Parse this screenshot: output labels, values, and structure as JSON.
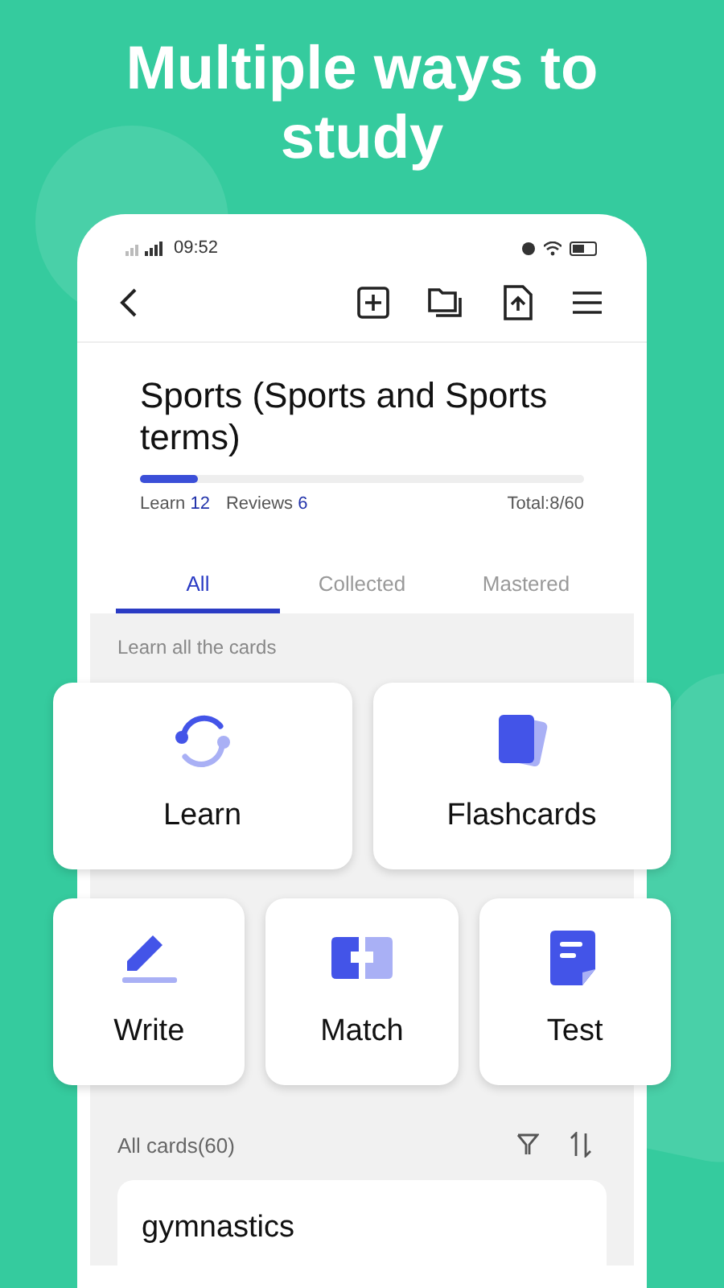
{
  "headline": "Multiple ways to study",
  "status_bar": {
    "time": "09:52"
  },
  "deck": {
    "title": "Sports (Sports and Sports terms)",
    "progress": {
      "level": 0.13
    },
    "learn_label": "Learn",
    "learn_count": "12",
    "reviews_label": "Reviews",
    "reviews_count": "6",
    "total": "Total:8/60"
  },
  "tabs": [
    {
      "label": "All",
      "selected": true
    },
    {
      "label": "Collected",
      "selected": false
    },
    {
      "label": "Mastered",
      "selected": false
    }
  ],
  "section_hint": "Learn all the cards",
  "modes": [
    {
      "kind": "learn",
      "label": "Learn"
    },
    {
      "kind": "flashcards",
      "label": "Flashcards"
    },
    {
      "kind": "write",
      "label": "Write"
    },
    {
      "kind": "match",
      "label": "Match"
    },
    {
      "kind": "test",
      "label": "Test"
    }
  ],
  "cards_header": "All cards(60)",
  "cards": [
    {
      "term": "gymnastics"
    }
  ]
}
